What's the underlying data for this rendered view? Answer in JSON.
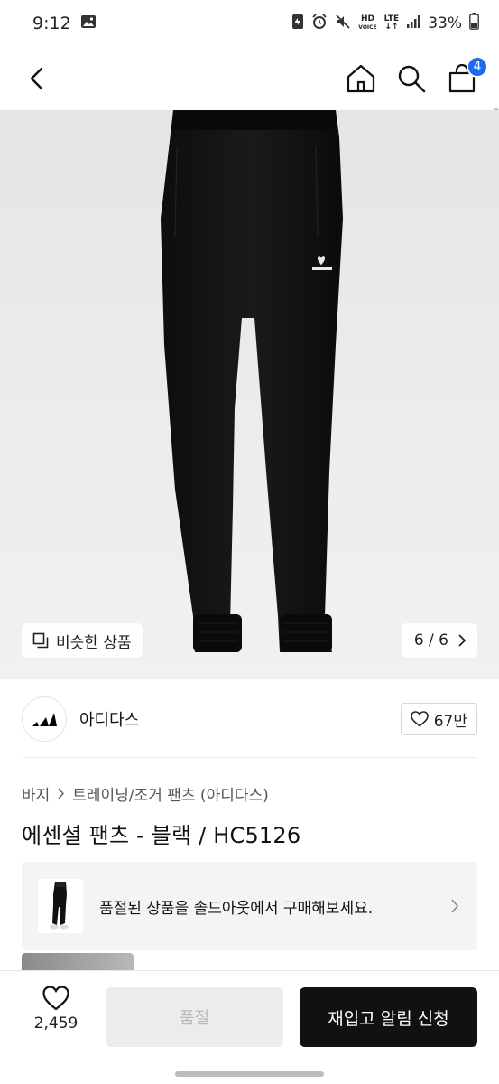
{
  "status_bar": {
    "time": "9:12",
    "network_top": "HD",
    "network_sub": "VOICE",
    "lte": "LTE",
    "battery": "33%"
  },
  "nav": {
    "cart_count": "4"
  },
  "gallery": {
    "similar_label": "비슷한 상품",
    "page_indicator": "6 / 6"
  },
  "brand": {
    "name": "아디다스",
    "likes": "67만"
  },
  "breadcrumb": {
    "category": "바지",
    "subcategory": "트레이닝/조거 팬츠 (아디다스)"
  },
  "product": {
    "title": "에센셜 팬츠 - 블랙 / HC5126"
  },
  "soldout_banner": {
    "text": "품절된 상품을 솔드아웃에서 구매해보세요."
  },
  "bottom_bar": {
    "wish_count": "2,459",
    "soldout_label": "품절",
    "restock_label": "재입고 알림 신청"
  },
  "colors": {
    "accent": "#1f6bf0",
    "primary_button": "#111111",
    "disabled_button": "#ececec"
  }
}
